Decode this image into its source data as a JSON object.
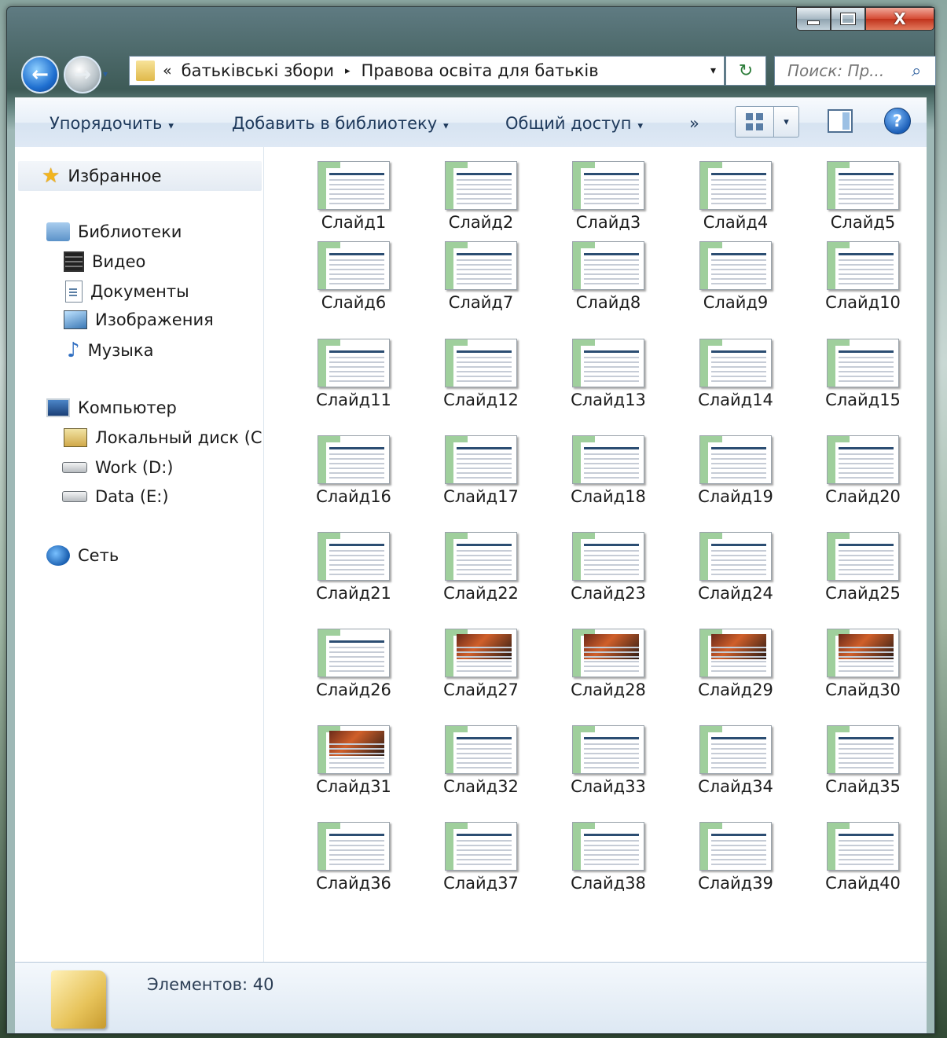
{
  "window": {
    "min_icon": "minimize-icon",
    "max_icon": "maximize-icon",
    "close_glyph": "X"
  },
  "address": {
    "chevrons": "«",
    "crumbs": [
      "батьківські збори",
      "Правова освіта для батьків"
    ],
    "separator": "▸",
    "dropdown": "▾",
    "search_placeholder": "Поиск: Пр...",
    "refresh_glyph": "↻",
    "search_glyph": "⌕"
  },
  "toolbar": {
    "organize": "Упорядочить",
    "add_library": "Добавить в библиотеку",
    "share": "Общий доступ",
    "more": "»",
    "caret": "▾",
    "help": "?"
  },
  "nav": {
    "favorites": "Избранное",
    "libraries": "Библиотеки",
    "video": "Видео",
    "documents": "Документы",
    "images": "Изображения",
    "music": "Музыка",
    "computer": "Компьютер",
    "local_disk": "Локальный диск (C",
    "work": "Work (D:)",
    "data": "Data (E:)",
    "network": "Сеть"
  },
  "files": [
    "Слайд1",
    "Слайд2",
    "Слайд3",
    "Слайд4",
    "Слайд5",
    "Слайд6",
    "Слайд7",
    "Слайд8",
    "Слайд9",
    "Слайд10",
    "Слайд11",
    "Слайд12",
    "Слайд13",
    "Слайд14",
    "Слайд15",
    "Слайд16",
    "Слайд17",
    "Слайд18",
    "Слайд19",
    "Слайд20",
    "Слайд21",
    "Слайд22",
    "Слайд23",
    "Слайд24",
    "Слайд25",
    "Слайд26",
    "Слайд27",
    "Слайд28",
    "Слайд29",
    "Слайд30",
    "Слайд31",
    "Слайд32",
    "Слайд33",
    "Слайд34",
    "Слайд35",
    "Слайд36",
    "Слайд37",
    "Слайд38",
    "Слайд39",
    "Слайд40"
  ],
  "photo_slides": [
    "Слайд27",
    "Слайд28",
    "Слайд29",
    "Слайд30",
    "Слайд31"
  ],
  "status": {
    "count": "Элементов: 40"
  },
  "colors": {
    "accent": "#1e395b",
    "slide_green": "#9fcf9c",
    "slide_blue": "#2b4d72"
  }
}
